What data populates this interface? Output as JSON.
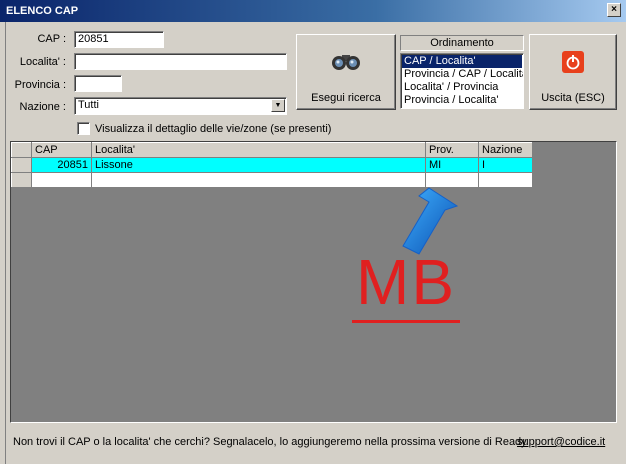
{
  "window": {
    "title": "ELENCO CAP",
    "close_glyph": "×"
  },
  "form": {
    "cap_label": "CAP :",
    "cap_value": "20851",
    "localita_label": "Localita' :",
    "localita_value": "",
    "provincia_label": "Provincia :",
    "provincia_value": "",
    "nazione_label": "Nazione :",
    "nazione_value": "Tutti",
    "detail_label": "Visualizza il dettaglio delle vie/zone (se presenti)"
  },
  "buttons": {
    "search_label": "Esegui ricerca",
    "exit_label": "Uscita (ESC)"
  },
  "ordinamento": {
    "title": "Ordinamento",
    "options": [
      "CAP / Localita'",
      "Provincia / CAP / Localita'",
      "Localita' / Provincia",
      "Provincia / Localita'"
    ],
    "selected_index": 0
  },
  "grid": {
    "columns": [
      "CAP",
      "Localita'",
      "Prov.",
      "Nazione"
    ],
    "rows": [
      {
        "cap": "20851",
        "localita": "Lissone",
        "prov": "MI",
        "nazione": "I"
      }
    ]
  },
  "annotation": {
    "text": "MB",
    "color": "#e02020"
  },
  "footer": {
    "message": "Non trovi il CAP o la localita' che cerchi? Segnalacelo, lo aggiungeremo nella prossima versione di Ready",
    "link": "support@codice.it"
  },
  "colors": {
    "highlight_row": "#00ffff",
    "title_bar": "#0a246a",
    "exit_icon": "#e8401c"
  }
}
